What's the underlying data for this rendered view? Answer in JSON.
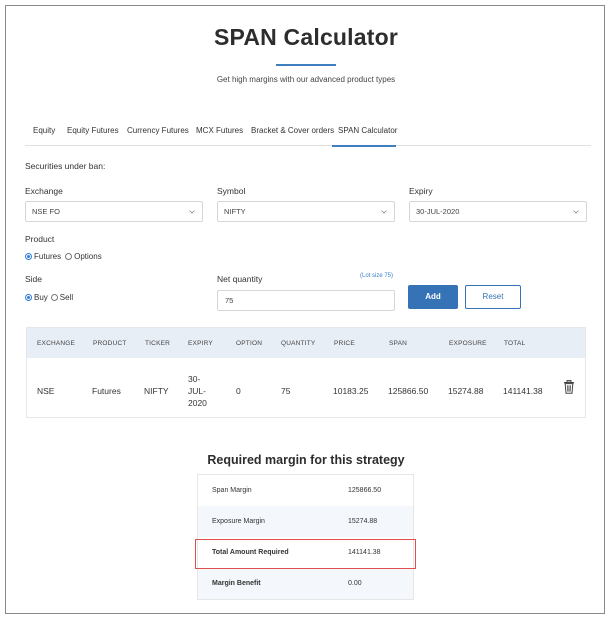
{
  "page": {
    "title": "SPAN Calculator",
    "subtitle": "Get high margins with our advanced product types",
    "accent": "#3f7fc0"
  },
  "tabs": [
    {
      "label": "Equity"
    },
    {
      "label": "Equity Futures"
    },
    {
      "label": "Currency Futures"
    },
    {
      "label": "MCX Futures"
    },
    {
      "label": "Bracket & Cover orders"
    },
    {
      "label": "SPAN Calculator",
      "active": true
    }
  ],
  "form": {
    "ban_label": "Securities under ban:",
    "exchange": {
      "label": "Exchange",
      "value": "NSE FO"
    },
    "symbol": {
      "label": "Symbol",
      "value": "NIFTY"
    },
    "expiry": {
      "label": "Expiry",
      "value": "30-JUL-2020"
    },
    "product": {
      "label": "Product",
      "options": [
        "Futures",
        "Options"
      ],
      "selected": "Futures"
    },
    "side": {
      "label": "Side",
      "options": [
        "Buy",
        "Sell"
      ],
      "selected": "Buy"
    },
    "net_quantity": {
      "label": "Net quantity",
      "value": "75",
      "lot_size": "(Lot size 75)"
    },
    "add_label": "Add",
    "reset_label": "Reset"
  },
  "table": {
    "headers": [
      "EXCHANGE",
      "PRODUCT",
      "TICKER",
      "EXPIRY",
      "OPTION",
      "QUANTITY",
      "PRICE",
      "SPAN",
      "EXPOSURE",
      "TOTAL"
    ],
    "rows": [
      {
        "exchange": "NSE",
        "product": "Futures",
        "ticker": "NIFTY",
        "expiry_line1": "30-",
        "expiry_line2": "JUL-",
        "expiry_line3": "2020",
        "option": "0",
        "quantity": "75",
        "price": "10183.25",
        "span": "125866.50",
        "exposure": "15274.88",
        "total": "141141.38"
      }
    ]
  },
  "summary": {
    "title": "Required margin for this strategy",
    "rows": [
      {
        "label": "Span Margin",
        "value": "125866.50"
      },
      {
        "label": "Exposure Margin",
        "value": "15274.88"
      },
      {
        "label": "Total Amount Required",
        "value": "141141.38",
        "highlighted": true
      },
      {
        "label": "Margin Benefit",
        "value": "0.00"
      }
    ],
    "highlight_color": "#e05050"
  }
}
